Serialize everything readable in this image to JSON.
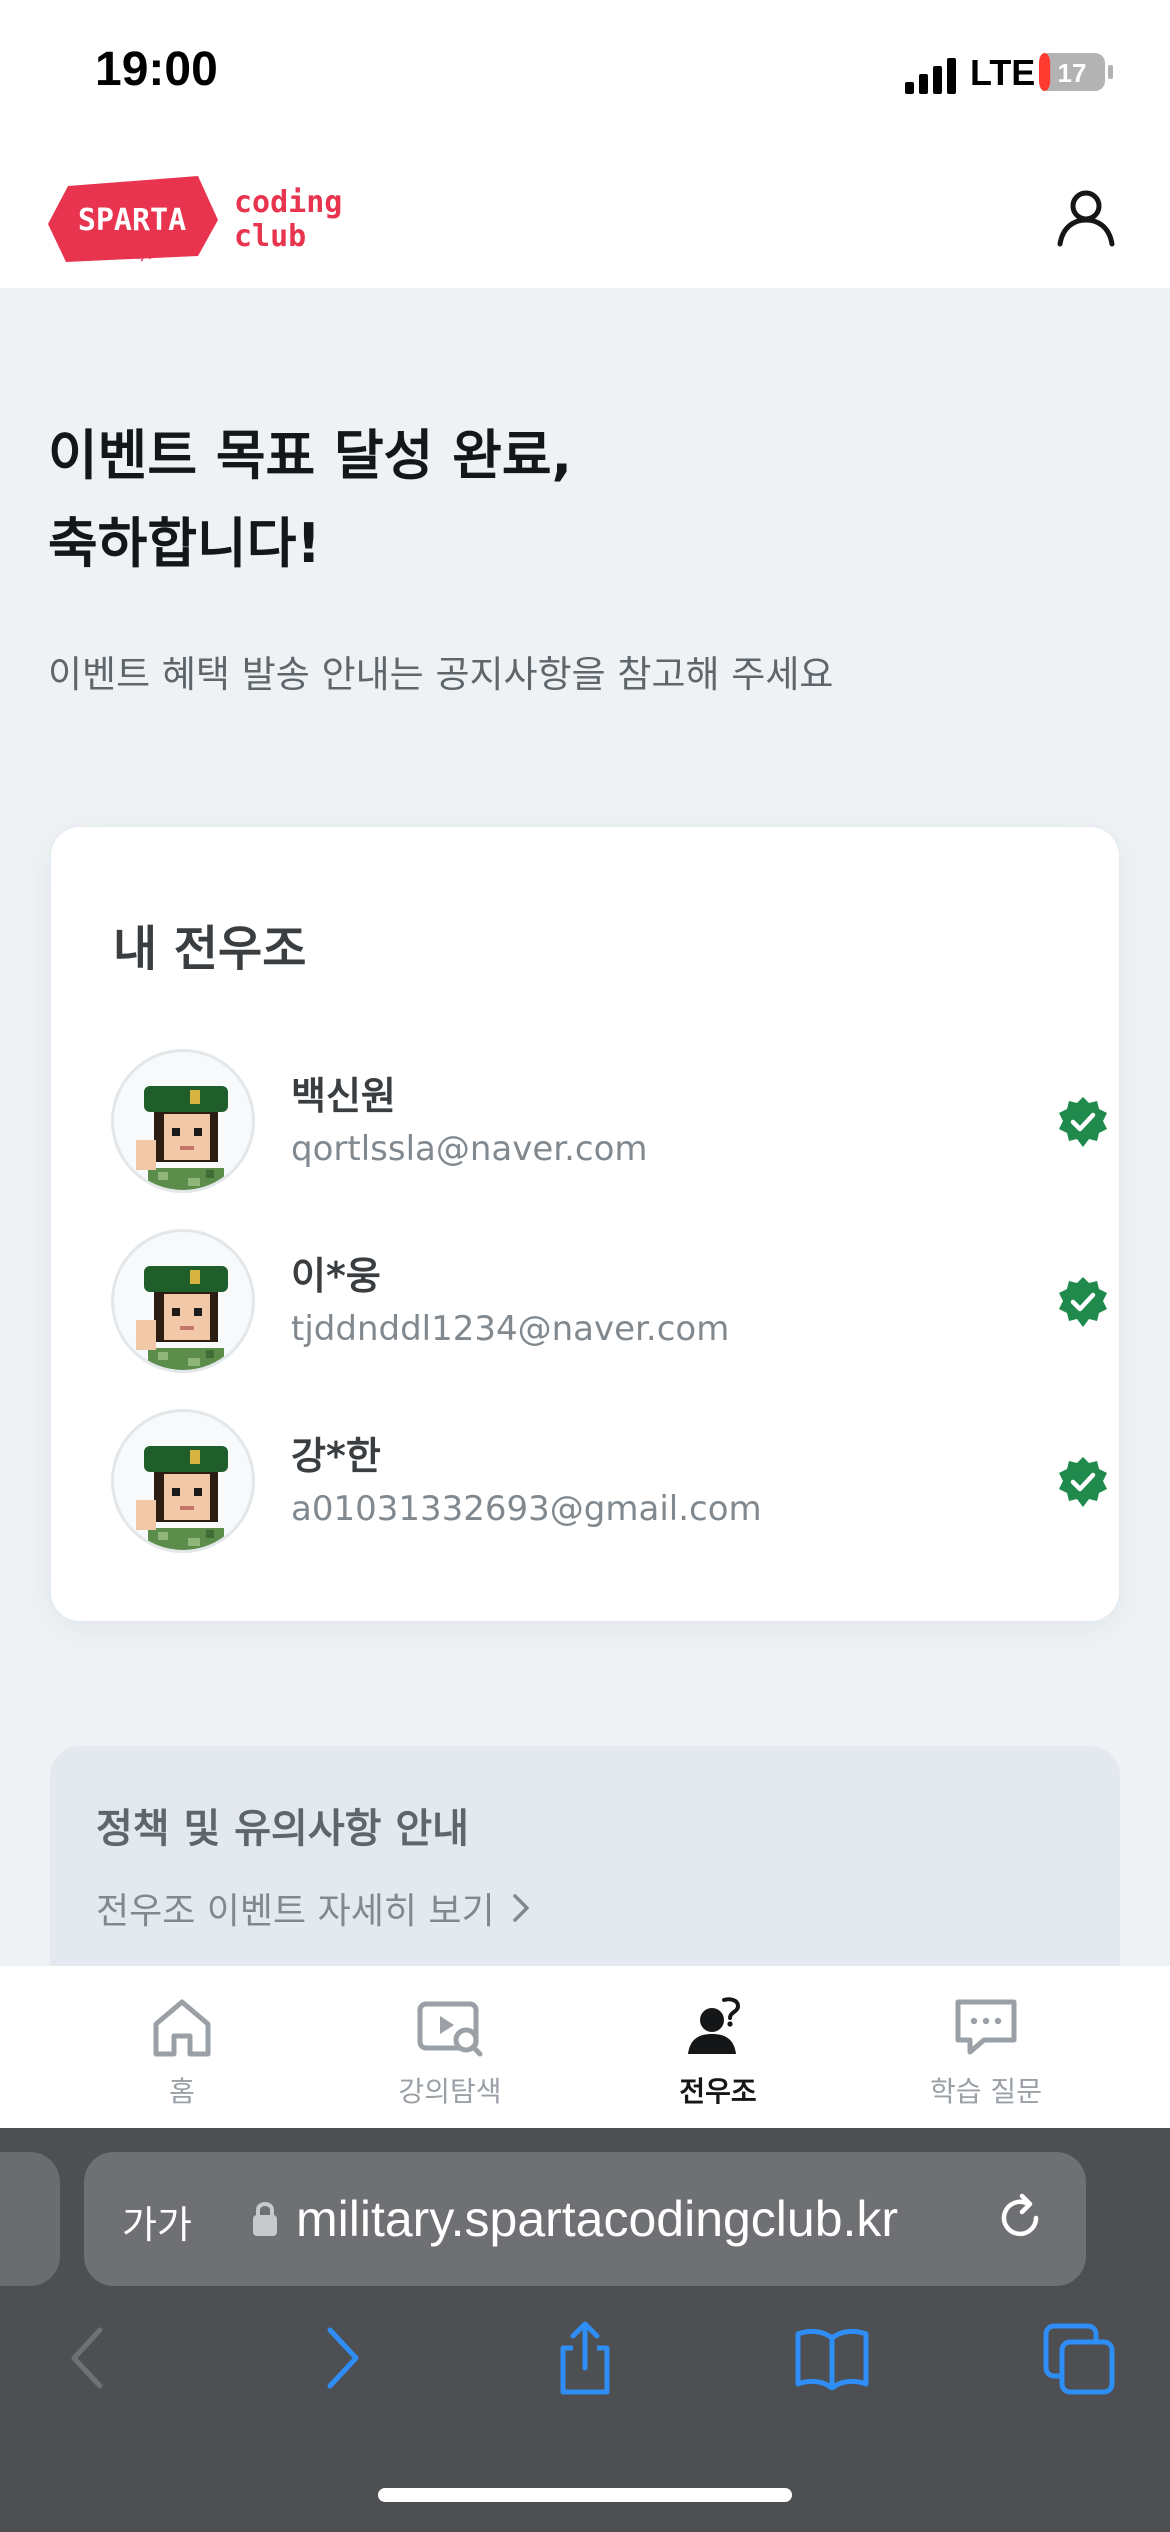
{
  "status_bar": {
    "time": "19:00",
    "network": "LTE",
    "battery": "17",
    "battery_level_percent": 17,
    "battery_color": "#ff3b30"
  },
  "header": {
    "logo_left": "SPARTA",
    "logo_right_line1": "coding",
    "logo_right_line2": "club",
    "logo_color": "#e8344e",
    "profile_icon": "user-icon"
  },
  "hero": {
    "title_line1": "이벤트 목표 달성 완료,",
    "title_line2": "축하합니다!",
    "subtitle": "이벤트 혜택 발송 안내는 공지사항을 참고해 주세요"
  },
  "members": {
    "title": "내 전우조",
    "items": [
      {
        "name": "백신원",
        "email": "qortlssla@naver.com",
        "verified": true
      },
      {
        "name": "이*웅",
        "email": "tjddnddl1234@naver.com",
        "verified": true
      },
      {
        "name": "강*한",
        "email": "a01031332693@gmail.com",
        "verified": true
      }
    ],
    "verified_color": "#1f8a4c"
  },
  "policy": {
    "title": "정책 및 유의사항 안내",
    "link_label": "전우조 이벤트 자세히 보기"
  },
  "tab_bar": {
    "items": [
      {
        "label": "홈",
        "icon": "home-icon",
        "active": false
      },
      {
        "label": "강의탐색",
        "icon": "video-search-icon",
        "active": false
      },
      {
        "label": "전우조",
        "icon": "group-icon",
        "active": true
      },
      {
        "label": "학습 질문",
        "icon": "chat-icon",
        "active": false
      }
    ]
  },
  "browser": {
    "text_size_label": "가가",
    "url": "military.spartacodingclub.kr",
    "accent_color": "#2f8df6"
  }
}
